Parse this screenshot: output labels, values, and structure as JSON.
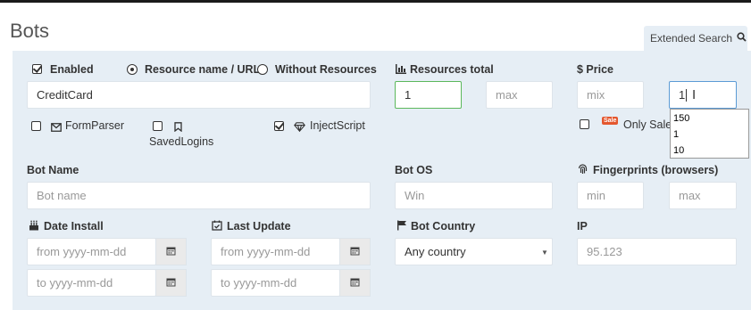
{
  "page": {
    "title": "Bots"
  },
  "extended_search": {
    "label": "Extended Search"
  },
  "filters": {
    "enabled_label": "Enabled",
    "resource_name_label": "Resource name / URL",
    "without_resources_label": "Without Resources",
    "resource_value": "CreditCard",
    "formparser_label": "FormParser",
    "savedlogins_label": "SavedLogins",
    "injectscript_label": "InjectScript",
    "resources_total_label": "Resources total",
    "resources_min_value": "1",
    "resources_max_placeholder": "max",
    "price_label": "$ Price",
    "price_min_placeholder": "mix",
    "price_max_value": "1",
    "sale_badge": "Sale",
    "only_sale_label": "Only Sale",
    "autocomplete": [
      "150",
      "1",
      "10"
    ],
    "bot_name_label": "Bot Name",
    "bot_name_placeholder": "Bot name",
    "bot_os_label": "Bot OS",
    "bot_os_placeholder": "Win",
    "fingerprints_label": "Fingerprints (browsers)",
    "fp_min_placeholder": "min",
    "fp_max_placeholder": "max",
    "date_install_label": "Date Install",
    "di_from_placeholder": "from yyyy-mm-dd",
    "di_to_placeholder": "to yyyy-mm-dd",
    "last_update_label": "Last Update",
    "lu_from_placeholder": "from yyyy-mm-dd",
    "lu_to_placeholder": "to yyyy-mm-dd",
    "bot_country_label": "Bot Country",
    "bot_country_value": "Any country",
    "ip_label": "IP",
    "ip_value": "95.123"
  }
}
